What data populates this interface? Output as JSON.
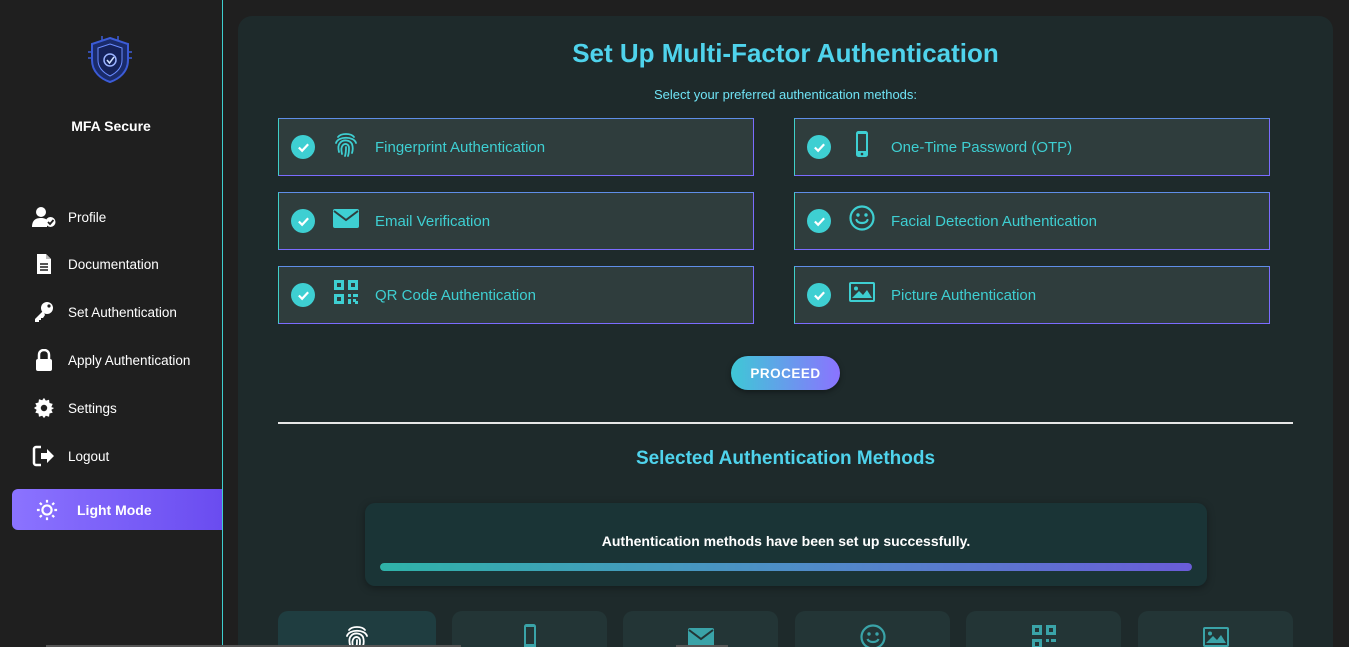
{
  "sidebar": {
    "brand": "MFA Secure",
    "items": [
      {
        "label": "Profile",
        "icon": "user-check-icon"
      },
      {
        "label": "Documentation",
        "icon": "document-icon"
      },
      {
        "label": "Set Authentication",
        "icon": "key-icon"
      },
      {
        "label": "Apply Authentication",
        "icon": "lock-icon"
      },
      {
        "label": "Settings",
        "icon": "gear-icon"
      },
      {
        "label": "Logout",
        "icon": "logout-icon"
      }
    ],
    "mode_toggle": {
      "label": "Light Mode",
      "icon": "sun-icon"
    }
  },
  "main": {
    "title": "Set Up Multi-Factor Authentication",
    "subtitle": "Select your preferred authentication methods:",
    "methods": [
      {
        "label": "Fingerprint Authentication",
        "icon": "fingerprint-icon",
        "selected": true
      },
      {
        "label": "One-Time Password (OTP)",
        "icon": "mobile-phone-icon",
        "selected": true
      },
      {
        "label": "Email Verification",
        "icon": "envelope-icon",
        "selected": true
      },
      {
        "label": "Facial Detection Authentication",
        "icon": "smiley-face-icon",
        "selected": true
      },
      {
        "label": "QR Code Authentication",
        "icon": "qr-code-icon",
        "selected": true
      },
      {
        "label": "Picture Authentication",
        "icon": "image-icon",
        "selected": true
      }
    ],
    "proceed_label": "PROCEED",
    "selected_title": "Selected Authentication Methods",
    "status_message": "Authentication methods have been set up successfully.",
    "progress": 1.0,
    "selected_cards": [
      "fingerprint-icon",
      "mobile-phone-icon",
      "envelope-icon",
      "smiley-face-icon",
      "qr-code-icon",
      "image-icon"
    ]
  },
  "colors": {
    "accent_cyan": "#4fd3ec",
    "accent_purple": "#7b6cff",
    "check_teal": "#3ecfd2"
  }
}
